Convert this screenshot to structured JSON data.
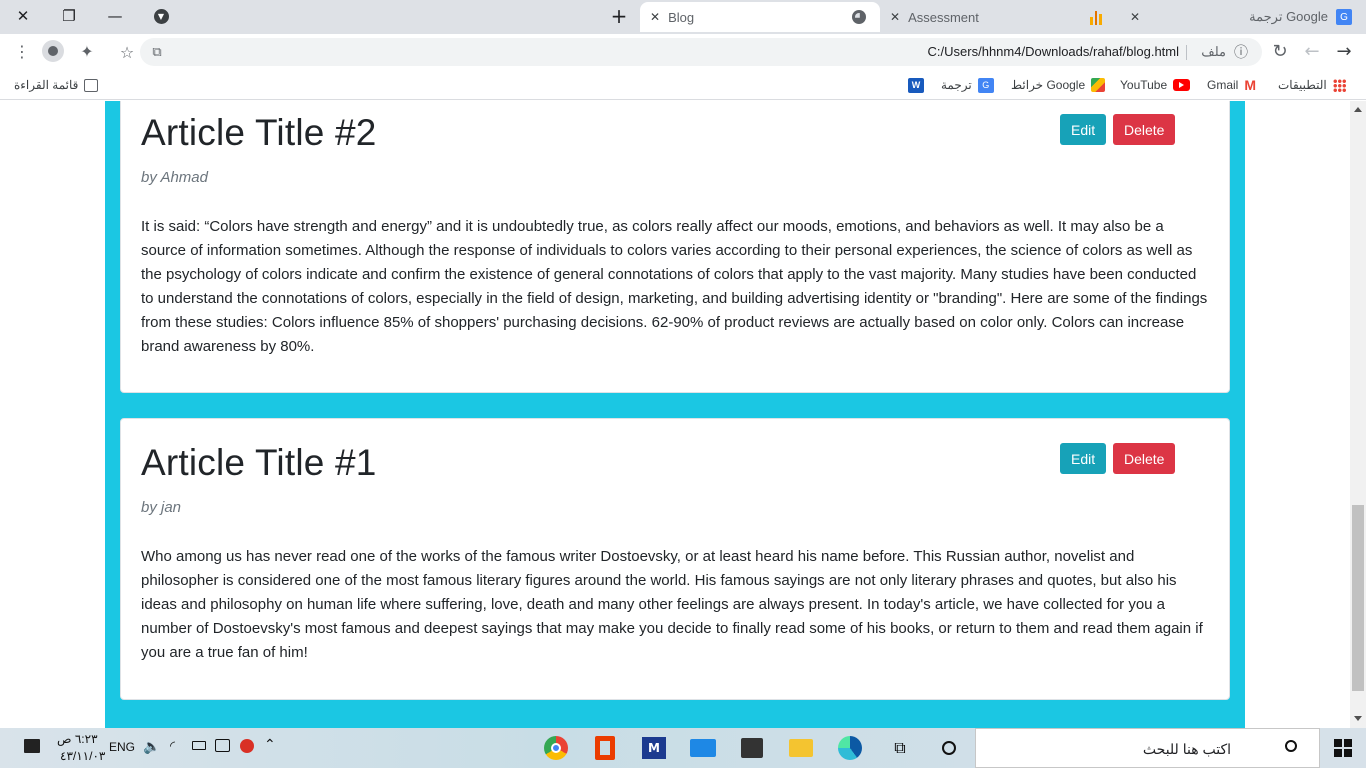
{
  "browser": {
    "tabs": [
      {
        "label": "Blog"
      },
      {
        "label": "Assessment"
      },
      {
        "label": "ترجمة Google"
      }
    ],
    "address": {
      "url": "C:/Users/hhnm4/Downloads/rahaf/blog.html",
      "scheme_label": "ملف"
    },
    "bookmarks": [
      {
        "label": "التطبيقات",
        "icon": "apps-grid-icon"
      },
      {
        "label": "Gmail",
        "icon": "gmail-icon"
      },
      {
        "label": "YouTube",
        "icon": "youtube-icon"
      },
      {
        "label": "خرائط Google",
        "icon": "maps-icon"
      },
      {
        "label": "ترجمة",
        "icon": "translate-icon"
      },
      {
        "label": "W",
        "icon": "word-icon"
      }
    ],
    "reading_list": "قائمة القراءة"
  },
  "articles": [
    {
      "title": "Article Title #2",
      "author": "by Ahmad",
      "body": "It is said: “Colors have strength and energy” and it is undoubtedly true, as colors really affect our moods, emotions, and behaviors as well. It may also be a source of information sometimes. Although the response of individuals to colors varies according to their personal experiences, the science of colors as well as the psychology of colors indicate and confirm the existence of general connotations of colors that apply to the vast majority. Many studies have been conducted to understand the connotations of colors, especially in the field of design, marketing, and building advertising identity or \"branding\". Here are some of the findings from these studies: Colors influence 85% of shoppers' purchasing decisions. 62-90% of product reviews are actually based on color only. Colors can increase brand awareness by 80%.",
      "edit_label": "Edit",
      "delete_label": "Delete"
    },
    {
      "title": "Article Title #1",
      "author": "by jan",
      "body": "Who among us has never read one of the works of the famous writer Dostoevsky, or at least heard his name before. This Russian author, novelist and philosopher is considered one of the most famous literary figures around the world. His famous sayings are not only literary phrases and quotes, but also his ideas and philosophy on human life where suffering, love, death and many other feelings are always present. In today's article, we have collected for you a number of Dostoevsky's most famous and deepest sayings that may make you decide to finally read some of his books, or return to them and read them again if you are a true fan of him!",
      "edit_label": "Edit",
      "delete_label": "Delete"
    }
  ],
  "taskbar": {
    "search_placeholder": "اكتب هنا للبحث",
    "language": "ENG",
    "time": "٦:٢٣ ص",
    "date": "٤٣/١١/٠٣"
  },
  "colors": {
    "container_bg": "#1bc7e3",
    "edit_btn": "#17a2b8",
    "delete_btn": "#dc3545"
  }
}
